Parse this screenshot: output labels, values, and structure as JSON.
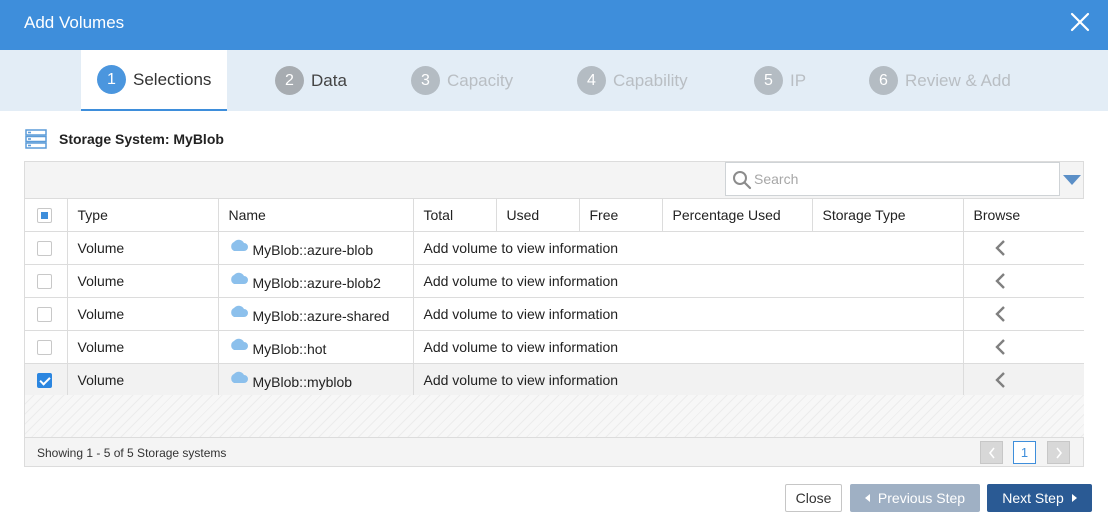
{
  "dialog": {
    "title": "Add Volumes"
  },
  "steps": [
    {
      "num": "1",
      "label": "Selections"
    },
    {
      "num": "2",
      "label": "Data"
    },
    {
      "num": "3",
      "label": "Capacity"
    },
    {
      "num": "4",
      "label": "Capability"
    },
    {
      "num": "5",
      "label": "IP"
    },
    {
      "num": "6",
      "label": "Review & Add"
    }
  ],
  "storage_system": {
    "label": "Storage System: MyBlob"
  },
  "search": {
    "placeholder": "Search"
  },
  "table": {
    "columns": [
      "Type",
      "Name",
      "Total",
      "Used",
      "Free",
      "Percentage Used",
      "Storage Type",
      "Browse"
    ],
    "rows": [
      {
        "type": "Volume",
        "name": "MyBlob::azure-blob",
        "info": "Add volume to view information",
        "checked": false
      },
      {
        "type": "Volume",
        "name": "MyBlob::azure-blob2",
        "info": "Add volume to view information",
        "checked": false
      },
      {
        "type": "Volume",
        "name": "MyBlob::azure-shared",
        "info": "Add volume to view information",
        "checked": false
      },
      {
        "type": "Volume",
        "name": "MyBlob::hot",
        "info": "Add volume to view information",
        "checked": false
      },
      {
        "type": "Volume",
        "name": "MyBlob::myblob",
        "info": "Add volume to view information",
        "checked": true
      }
    ]
  },
  "footer": {
    "status": "Showing 1 - 5 of 5 Storage systems",
    "current_page": "1"
  },
  "buttons": {
    "close": "Close",
    "previous": "Previous Step",
    "next": "Next Step"
  },
  "colors": {
    "header": "#3e8edb",
    "steps_bg": "#e3edf6",
    "next_button": "#2a5a94",
    "prev_button": "#9fb0c4",
    "checkbox": "#2b86e0"
  }
}
